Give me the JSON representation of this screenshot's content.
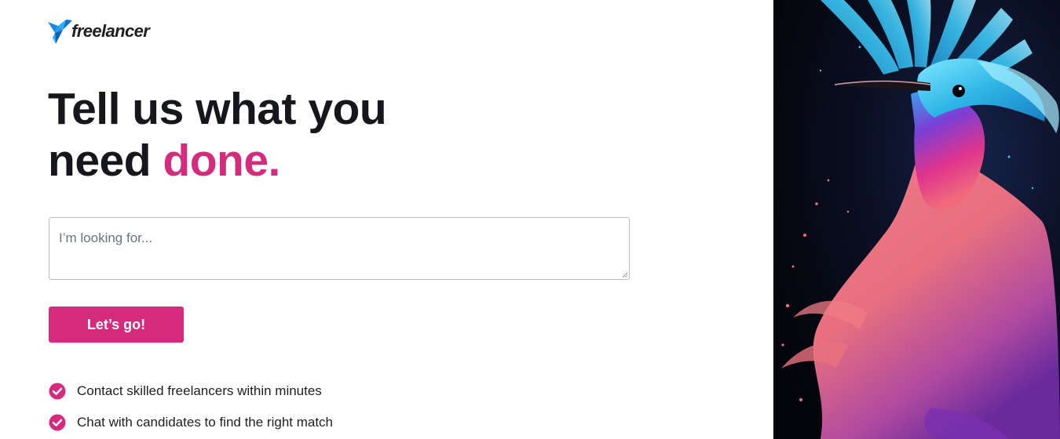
{
  "brand": {
    "name": "freelancer",
    "logo_icon": "bird-logo-icon",
    "colors": {
      "accent": "#d42b7e",
      "logo_blue": "#29b2fe",
      "text_dark": "#16161d"
    }
  },
  "headline": {
    "line1": "Tell us what you",
    "line2_prefix": "need",
    "line2_accent": "done."
  },
  "search": {
    "placeholder": "I’m looking for...",
    "value": ""
  },
  "cta": {
    "label": "Let’s go!"
  },
  "benefits": [
    {
      "icon": "check-circle-icon",
      "text": "Contact skilled freelancers within minutes"
    },
    {
      "icon": "check-circle-icon",
      "text": "Chat with candidates to find the right match"
    }
  ],
  "hero_image": {
    "subject": "hummingbird-illustration"
  }
}
